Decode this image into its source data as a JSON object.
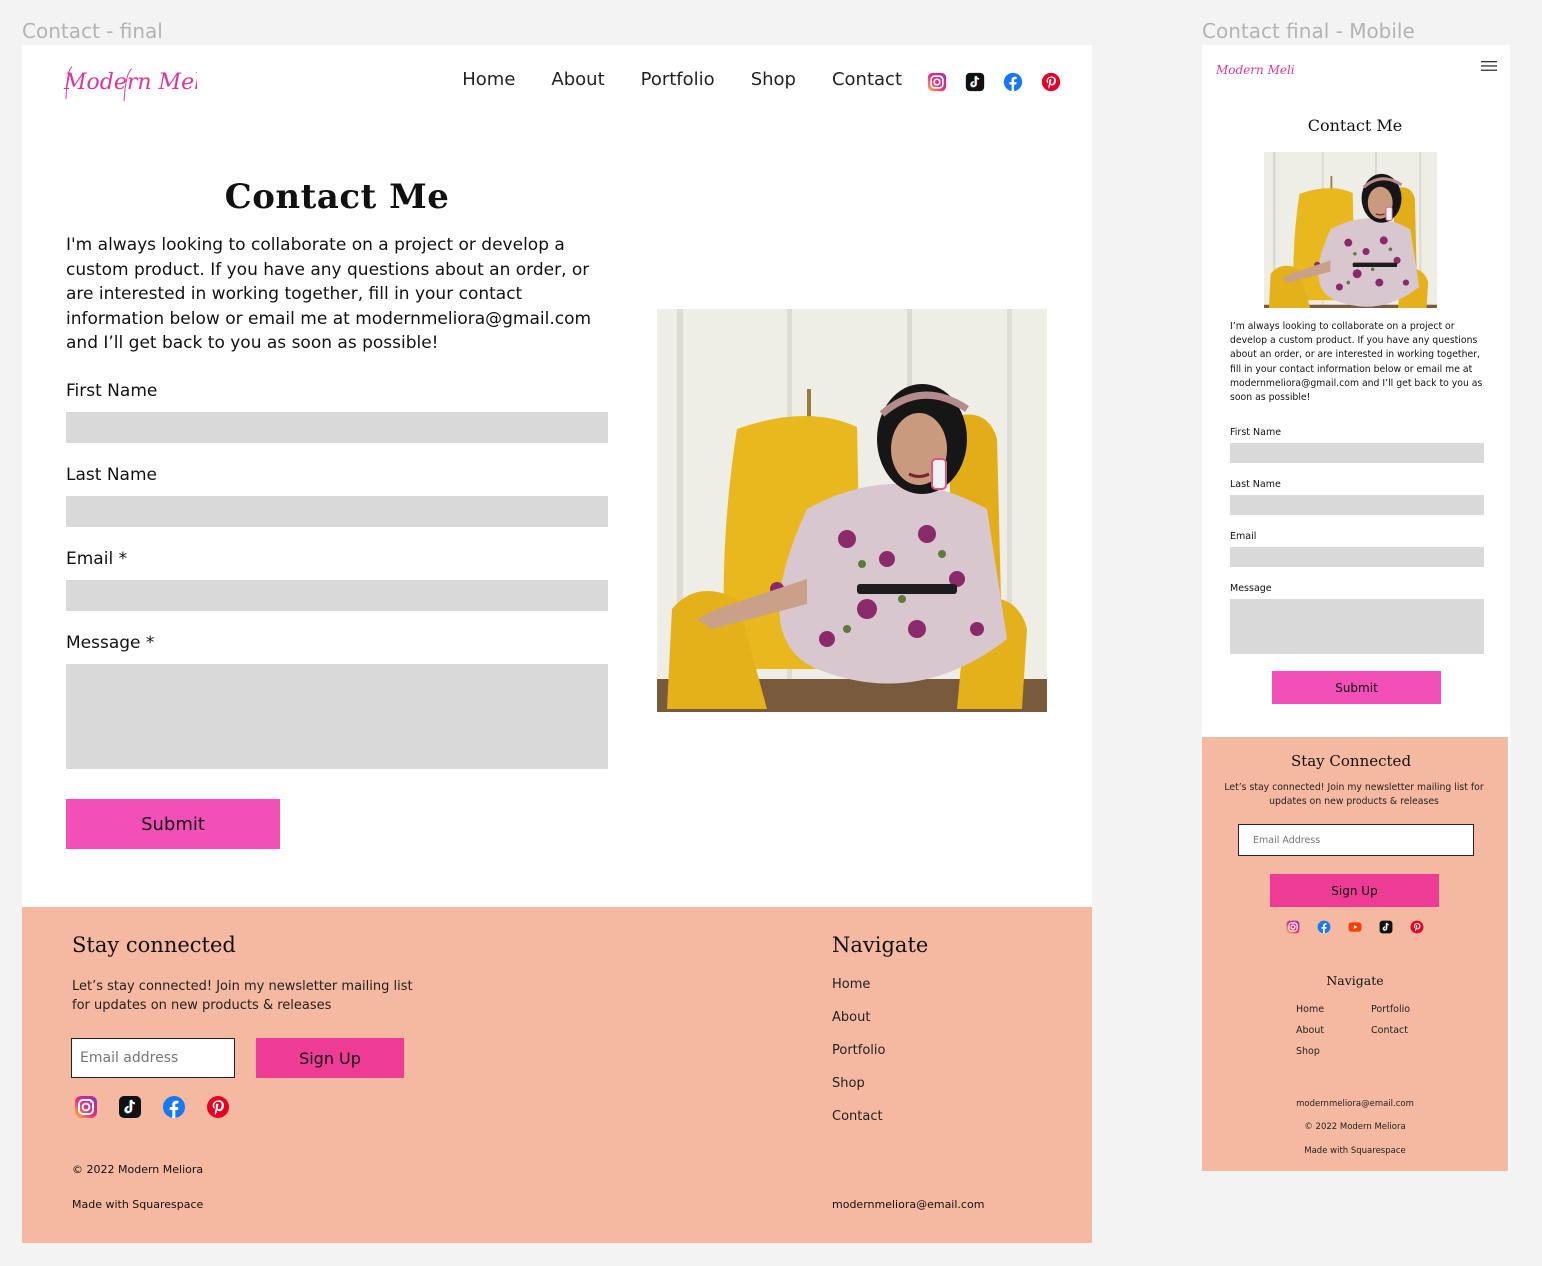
{
  "frames": {
    "desktop_label": "Contact - final",
    "mobile_label": "Contact final - Mobile"
  },
  "brand": {
    "logo_text": "Modern Meliora",
    "accent_pink": "#f24fb8",
    "signup_pink": "#ee3b95",
    "footer_bg": "#f5b9a1",
    "input_bg": "#d9d9d9",
    "logo_color": "#e0369a"
  },
  "desktop": {
    "nav": [
      "Home",
      "About",
      "Portfolio",
      "Shop",
      "Contact"
    ],
    "social_icons": [
      "instagram-icon",
      "tiktok-icon",
      "facebook-icon",
      "pinterest-icon"
    ],
    "title": "Contact Me",
    "intro": "I'm always looking to collaborate on a project or develop a custom product. If you have any questions about an order, or are interested in working together, fill in your contact information below or email me at modernmeliora@gmail.com and I’ll get back to you as soon as possible!",
    "form": {
      "first_name_label": "First Name",
      "last_name_label": "Last Name",
      "email_label": "Email *",
      "message_label": "Message *",
      "submit_label": "Submit"
    },
    "footer": {
      "title": "Stay connected",
      "text": "Let’s stay connected! Join my newsletter mailing list for updates on new products & releases",
      "email_placeholder": "Email address",
      "signup_label": "Sign Up",
      "social_icons": [
        "instagram-icon",
        "tiktok-icon",
        "facebook-icon",
        "pinterest-icon"
      ],
      "copyright": "© 2022 Modern Meliora",
      "made_with": "Made with Squarespace",
      "nav_title": "Navigate",
      "nav": [
        "Home",
        "About",
        "Portfolio",
        "Shop",
        "Contact"
      ],
      "email": "modernmeliora@email.com"
    }
  },
  "mobile": {
    "title": "Contact Me",
    "intro": "I’m always looking to collaborate on a project or develop a custom product. If you have any questions about an order, or are interested in working together, fill in your contact information below or email me at modernmeliora@gmail.com and I’ll get back to you as soon as possible!",
    "form": {
      "first_name_label": "First Name",
      "last_name_label": "Last Name",
      "email_label": "Email",
      "message_label": "Message",
      "submit_label": "Submit"
    },
    "footer": {
      "title": "Stay Connected",
      "text": "Let’s stay connected! Join my newsletter mailing list for updates on new products & releases",
      "email_placeholder": "Email Address",
      "signup_label": "Sign Up",
      "social_icons": [
        "instagram-icon",
        "facebook-icon",
        "youtube-icon",
        "tiktok-icon",
        "pinterest-icon"
      ],
      "nav_title": "Navigate",
      "nav": [
        "Home",
        "Portfolio",
        "About",
        "Contact",
        "Shop"
      ],
      "email": "modernmeliora@email.com",
      "copyright": "© 2022 Modern Meliora",
      "made_with": "Made with Squarespace"
    }
  }
}
